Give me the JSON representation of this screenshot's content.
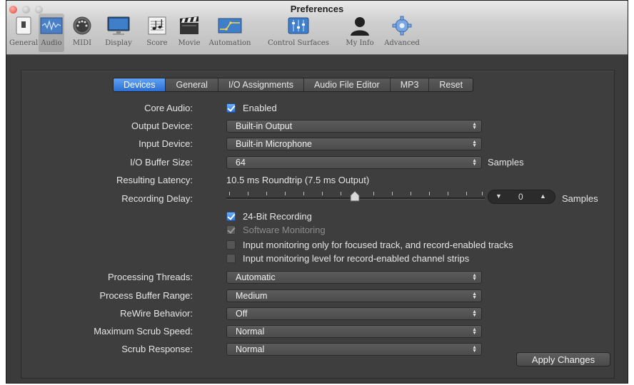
{
  "window": {
    "title": "Preferences"
  },
  "toolbar": {
    "items": [
      {
        "label": "General",
        "icon": "general-switch-icon"
      },
      {
        "label": "Audio",
        "icon": "audio-waveform-icon",
        "selected": true
      },
      {
        "label": "MIDI",
        "icon": "midi-connector-icon"
      },
      {
        "label": "Display",
        "icon": "display-monitor-icon"
      },
      {
        "label": "Score",
        "icon": "score-notes-icon"
      },
      {
        "label": "Movie",
        "icon": "movie-clapper-icon"
      },
      {
        "label": "Automation",
        "icon": "automation-curve-icon"
      },
      {
        "label": "Control Surfaces",
        "icon": "control-surfaces-mixer-icon"
      },
      {
        "label": "My Info",
        "icon": "user-silhouette-icon"
      },
      {
        "label": "Advanced",
        "icon": "gear-icon"
      }
    ]
  },
  "tabs": [
    {
      "label": "Devices",
      "active": true
    },
    {
      "label": "General"
    },
    {
      "label": "I/O Assignments"
    },
    {
      "label": "Audio File Editor"
    },
    {
      "label": "MP3"
    },
    {
      "label": "Reset"
    }
  ],
  "core_audio": {
    "label": "Core Audio:",
    "checkbox_label": "Enabled",
    "checked": true
  },
  "output_device": {
    "label": "Output Device:",
    "value": "Built-in Output"
  },
  "input_device": {
    "label": "Input Device:",
    "value": "Built-in Microphone"
  },
  "io_buffer": {
    "label": "I/O Buffer Size:",
    "value": "64",
    "suffix": "Samples"
  },
  "latency": {
    "label": "Resulting Latency:",
    "value": "10.5 ms Roundtrip (7.5 ms Output)"
  },
  "recording_delay": {
    "label": "Recording Delay:",
    "value": "0",
    "suffix": "Samples",
    "down": "▼",
    "up": "▲"
  },
  "checkboxes": [
    {
      "label": "24-Bit Recording",
      "checked": true,
      "enabled": true
    },
    {
      "label": "Software Monitoring",
      "checked": true,
      "enabled": false
    },
    {
      "label": "Input monitoring only for focused track, and record-enabled tracks",
      "checked": false,
      "enabled": true
    },
    {
      "label": "Input monitoring level for record-enabled channel strips",
      "checked": false,
      "enabled": true
    }
  ],
  "processing_threads": {
    "label": "Processing Threads:",
    "value": "Automatic"
  },
  "process_buffer_range": {
    "label": "Process Buffer Range:",
    "value": "Medium"
  },
  "rewire_behavior": {
    "label": "ReWire Behavior:",
    "value": "Off"
  },
  "max_scrub_speed": {
    "label": "Maximum Scrub Speed:",
    "value": "Normal"
  },
  "scrub_response": {
    "label": "Scrub Response:",
    "value": "Normal"
  },
  "apply_button": {
    "label": "Apply Changes"
  },
  "select_arrows": "▲\n▼",
  "colors": {
    "accent": "#2d6fd2",
    "background": "#3e3e3e",
    "close": "#e0443a"
  }
}
